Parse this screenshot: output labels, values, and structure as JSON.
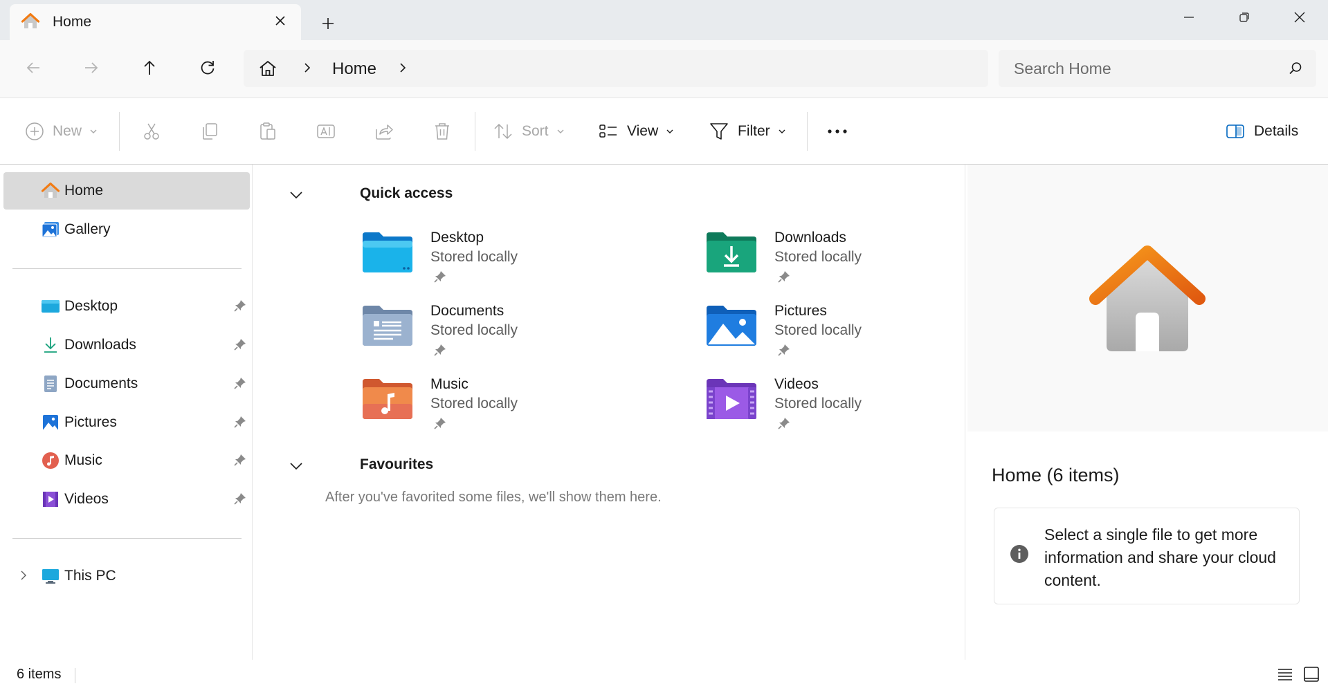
{
  "window": {
    "tab_title": "Home",
    "new_tab_symbol": "+"
  },
  "address": {
    "crumb": "Home",
    "search_placeholder": "Search Home"
  },
  "commands": {
    "new": "New",
    "sort": "Sort",
    "view": "View",
    "filter": "Filter",
    "details": "Details"
  },
  "sidebar": {
    "top_items": [
      {
        "label": "Home",
        "icon": "home-icon",
        "selected": true
      },
      {
        "label": "Gallery",
        "icon": "gallery-icon"
      }
    ],
    "pinned_items": [
      {
        "label": "Desktop",
        "icon": "desktop-icon"
      },
      {
        "label": "Downloads",
        "icon": "downloads-icon"
      },
      {
        "label": "Documents",
        "icon": "documents-icon"
      },
      {
        "label": "Pictures",
        "icon": "pictures-icon"
      },
      {
        "label": "Music",
        "icon": "music-icon"
      },
      {
        "label": "Videos",
        "icon": "videos-icon"
      }
    ],
    "this_pc": "This PC"
  },
  "main": {
    "quick_access_title": "Quick access",
    "quick_access_items": [
      {
        "name": "Desktop",
        "sub": "Stored locally"
      },
      {
        "name": "Downloads",
        "sub": "Stored locally"
      },
      {
        "name": "Documents",
        "sub": "Stored locally"
      },
      {
        "name": "Pictures",
        "sub": "Stored locally"
      },
      {
        "name": "Music",
        "sub": "Stored locally"
      },
      {
        "name": "Videos",
        "sub": "Stored locally"
      }
    ],
    "favourites_title": "Favourites",
    "favourites_empty": "After you've favorited some files, we'll show them here."
  },
  "details_pane": {
    "title": "Home (6 items)",
    "info": "Select a single file to get more information and share your cloud content."
  },
  "status": {
    "count": "6 items"
  },
  "colors": {
    "accent": "#0067c0",
    "home_orange": "#f27b13",
    "selected_bg": "#dadada"
  }
}
